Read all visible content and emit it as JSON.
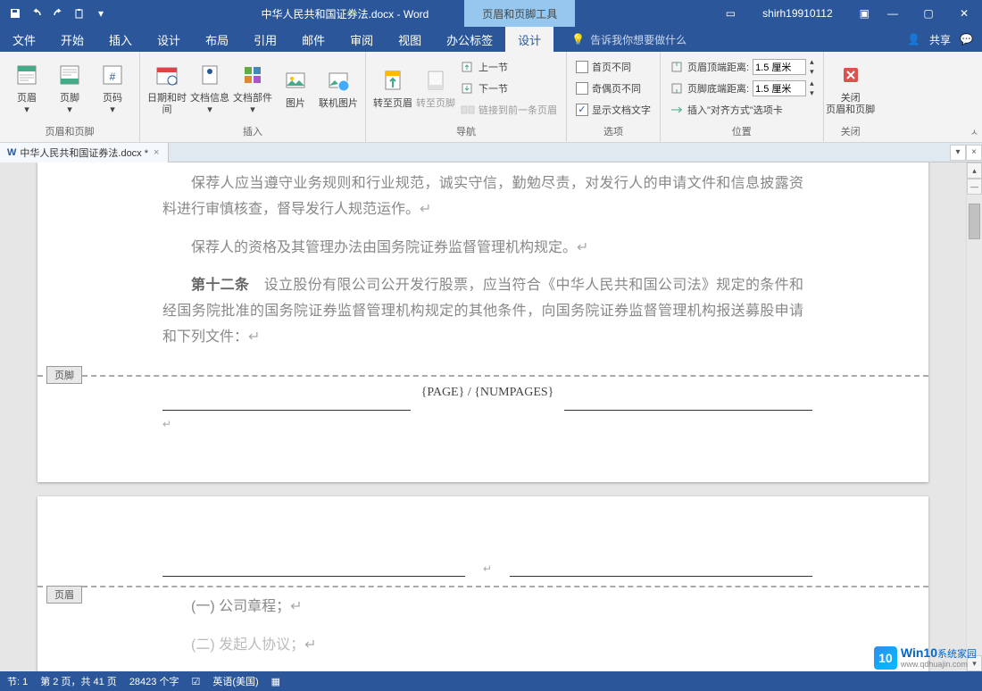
{
  "titlebar": {
    "doc_title": "中华人民共和国证券法.docx - Word",
    "context_label": "页眉和页脚工具",
    "username": "shirh19910112"
  },
  "tabs": {
    "file": "文件",
    "home": "开始",
    "insert": "插入",
    "design": "设计",
    "layout": "布局",
    "references": "引用",
    "mailings": "邮件",
    "review": "审阅",
    "view": "视图",
    "office_tab": "办公标签",
    "hf_design": "设计",
    "tell_me": "告诉我你想要做什么",
    "share": "共享"
  },
  "ribbon": {
    "g1": {
      "header": "页眉",
      "footer": "页脚",
      "page_number": "页码",
      "label": "页眉和页脚"
    },
    "g2": {
      "date_time": "日期和时间",
      "doc_info": "文档信息",
      "doc_parts": "文档部件",
      "picture": "图片",
      "online_pic": "联机图片",
      "label": "插入"
    },
    "g3": {
      "goto_header": "转至页眉",
      "goto_footer": "转至页脚",
      "prev": "上一节",
      "next": "下一节",
      "link_prev": "链接到前一条页眉",
      "label": "导航"
    },
    "g4": {
      "first_page": "首页不同",
      "odd_even": "奇偶页不同",
      "show_doc": "显示文档文字",
      "label": "选项"
    },
    "g5": {
      "top_label": "页眉顶端距离:",
      "top_val": "1.5 厘米",
      "bottom_label": "页脚底端距离:",
      "bottom_val": "1.5 厘米",
      "insert_align": "插入\"对齐方式\"选项卡",
      "label": "位置"
    },
    "g6": {
      "close": "关闭\n页眉和页脚",
      "label": "关闭"
    }
  },
  "doc_tab": {
    "name": "中华人民共和国证券法.docx *"
  },
  "body": {
    "p1": "保荐人应当遵守业务规则和行业规范，诚实守信，勤勉尽责，对发行人的申请文件和信息披露资料进行审慎核查，督导发行人规范运作。",
    "p2": "保荐人的资格及其管理办法由国务院证券监督管理机构规定。",
    "p3_strong": "第十二条",
    "p3_rest": "　设立股份有限公司公开发行股票，应当符合《中华人民共和国公司法》规定的条件和经国务院批准的国务院证券监督管理机构规定的其他条件，向国务院证券监督管理机构报送募股申请和下列文件：",
    "footer_tag": "页脚",
    "header_tag": "页眉",
    "footer_field": "{PAGE} / {NUMPAGES}",
    "p4": "(一) 公司章程；",
    "p5": "(二) 发起人协议；"
  },
  "status": {
    "section": "节: 1",
    "page": "第 2 页，共 41 页",
    "words": "28423 个字",
    "lang": "英语(美国)"
  },
  "watermark": {
    "brand": "Win10",
    "sub": "系统家园",
    "url": "www.qdhuajin.com"
  }
}
